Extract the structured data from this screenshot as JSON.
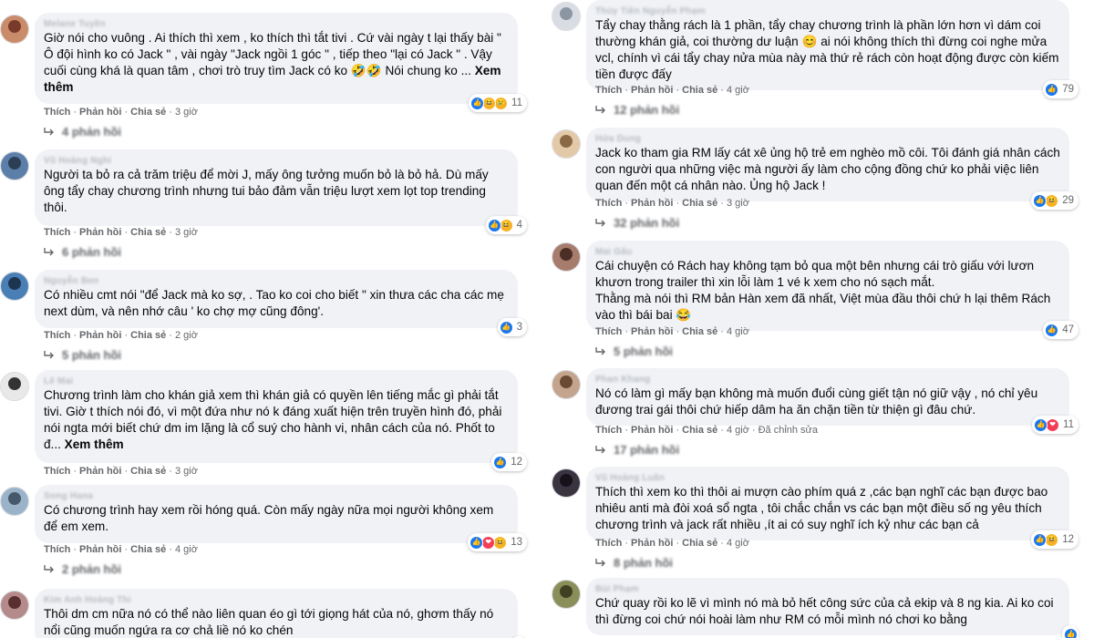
{
  "left_comments": [
    {
      "author": "Melane Tuyền",
      "text": "Giờ nói cho vuông . Ai thích thì xem , ko thích thì tắt tivi . Cứ vài ngày t lại thấy bài \" Ô đội hình ko có Jack \" , vài ngày \"Jack ngồi 1 góc \" , tiếp theo \"lại có Jack \" . Vậy cuối cùng khá là quan tâm , chơi trò truy tìm Jack có ko 🤣🤣 Nói chung ko ...",
      "see_more": "Xem thêm",
      "reactions": [
        "like",
        "haha",
        "sad"
      ],
      "reaction_count": "11",
      "action_like": "Thích",
      "action_reply": "Phản hồi",
      "action_share": "Chia sẻ",
      "time": "3 giờ",
      "replies": "4 phản hồi",
      "avatar_colors": [
        "#c98b6a",
        "#7a3a2a"
      ]
    },
    {
      "author": "Vũ Hoàng Nghi",
      "text": "Người ta bỏ ra cả trăm triệu để mời J, mấy ông tưởng muốn bỏ là bỏ hả. Dù mấy ông tẩy chay chương trình nhưng tui bảo đảm vẫn triệu lượt xem lọt top trending thôi.",
      "see_more": "",
      "reactions": [
        "like",
        "haha"
      ],
      "reaction_count": "4",
      "action_like": "Thích",
      "action_reply": "Phản hồi",
      "action_share": "Chia sẻ",
      "time": "3 giờ",
      "replies": "6 phản hồi",
      "avatar_colors": [
        "#5b7fa8",
        "#2b3e55"
      ]
    },
    {
      "author": "Nguyễn Ben",
      "text": "Có nhiều cmt nói \"để Jack mà ko sợ, . Tao ko coi cho biết \" xin thưa các cha các mẹ next dùm, và nên nhớ câu ' ko chợ mợ cũng đông'.",
      "see_more": "",
      "reactions": [
        "like"
      ],
      "reaction_count": "3",
      "action_like": "Thích",
      "action_reply": "Phản hồi",
      "action_share": "Chia sẻ",
      "time": "2 giờ",
      "replies": "5 phản hồi",
      "avatar_colors": [
        "#4a7fb5",
        "#1d3550"
      ]
    },
    {
      "author": "Lê Mai",
      "text": "Chương trình làm cho khán giả xem thì khán giả có quyền lên tiếng mắc gì phải tắt tivi. Giờ t thích nói đó, vì một đứa như nó k đáng xuất hiện trên truyền hình đó, phải nói ngta mới biết chứ dm im lặng là cổ suý cho hành vi, nhân cách của nó. Phốt to đ...",
      "see_more": "Xem thêm",
      "reactions": [
        "like"
      ],
      "reaction_count": "12",
      "action_like": "Thích",
      "action_reply": "Phản hồi",
      "action_share": "Chia sẻ",
      "time": "3 giờ",
      "replies": "",
      "avatar_colors": [
        "#e8e8e8",
        "#333333"
      ]
    },
    {
      "author": "Song Hana",
      "text": "Có chương trình hay xem rồi hóng quá. Còn mấy ngày nữa mọi người không xem để em xem.",
      "see_more": "",
      "reactions": [
        "like",
        "love",
        "haha"
      ],
      "reaction_count": "13",
      "action_like": "Thích",
      "action_reply": "Phản hồi",
      "action_share": "Chia sẻ",
      "time": "4 giờ",
      "replies": "2 phản hồi",
      "avatar_colors": [
        "#9bb3c9",
        "#46586b"
      ]
    },
    {
      "author": "Kim Anh Hoàng Thi",
      "text": "Thôi dm cm nữa nó có thể nào liên quan éo gì tới giọng hát của nó, ghơm thấy nó nổi cũng muốn ngứa ra cơ chả liề nó ko chén",
      "see_more": "",
      "reactions": [
        "like"
      ],
      "reaction_count": "",
      "action_like": "",
      "action_reply": "",
      "action_share": "",
      "time": "",
      "replies": "",
      "avatar_colors": [
        "#b48a8a",
        "#5a2f2f"
      ]
    }
  ],
  "right_comments": [
    {
      "author": "Thủy Tiên Nguyễn Phạm",
      "text": "Tẩy chay thằng rách là 1 phần, tẩy chay chương trình là phần lớn hơn vì dám coi thường khán giả, coi thường dư luận 😊 ai nói không thích thì đừng coi nghe mửa vcl, chính vì cái tẩy chay nửa mùa này mà thứ rẻ rách còn hoạt động được còn kiếm tiền được đấy",
      "see_more": "",
      "reactions": [
        "like"
      ],
      "reaction_count": "79",
      "action_like": "Thích",
      "action_reply": "Phản hồi",
      "action_share": "Chia sẻ",
      "time": "4 giờ",
      "replies": "12 phản hồi",
      "avatar_colors": [
        "#d9dde3",
        "#8c96a3"
      ]
    },
    {
      "author": "Hứa Dung",
      "text": "Jack ko tham gia RM lấy cát xê ủng hộ trẻ em nghèo mồ côi. Tôi đánh giá nhân cách con người qua những việc mà người ấy làm cho cộng đồng chứ ko phải việc liên quan đến một cá nhân nào. Ủng hộ Jack !",
      "see_more": "",
      "reactions": [
        "like",
        "haha"
      ],
      "reaction_count": "29",
      "action_like": "Thích",
      "action_reply": "Phản hồi",
      "action_share": "Chia sẻ",
      "time": "3 giờ",
      "replies": "32 phản hồi",
      "avatar_colors": [
        "#e3c9a8",
        "#8a6a45"
      ]
    },
    {
      "author": "Mai Gấu",
      "text": "Cái chuyện có Rách hay không tạm bỏ qua một bên nhưng cái trò giấu với lươn khươn trong trailer thì xin lỗi làm 1 vé k xem cho nó sạch mắt.\nThằng mà nói thì RM bản Hàn xem đã nhất, Việt mùa đầu thôi chứ h lại thêm Rách vào thì bái bai 😂",
      "see_more": "",
      "reactions": [
        "like"
      ],
      "reaction_count": "47",
      "action_like": "Thích",
      "action_reply": "Phản hồi",
      "action_share": "Chia sẻ",
      "time": "4 giờ",
      "replies": "5 phản hồi",
      "avatar_colors": [
        "#a67c6d",
        "#4b2e25"
      ]
    },
    {
      "author": "Phan Khang",
      "text": "Nó có làm gì mấy bạn không mà muốn đuổi cùng giết tận nó giữ vậy , nó chỉ yêu đương trai gái thôi chứ hiếp dâm ha ăn chặn tiền từ thiện gì đâu chứ.",
      "see_more": "",
      "reactions": [
        "like",
        "love"
      ],
      "reaction_count": "11",
      "action_like": "Thích",
      "action_reply": "Phản hồi",
      "action_share": "Chia sẻ",
      "time": "4 giờ",
      "edited": "Đã chỉnh sửa",
      "replies": "17 phản hồi",
      "avatar_colors": [
        "#c4a48d",
        "#6b4a35"
      ]
    },
    {
      "author": "Vũ Hoàng Luân",
      "text": "Thích thì xem ko thì thôi ai mượn cào phím quá z ,các bạn nghĩ các bạn được bao nhiêu anti mà đòi xoá sổ ngta , tôi chắc chắn vs các bạn một điều số ng yêu thích chương trình và jack rất nhiều ,ít ai có suy nghĩ ích kỷ như các bạn cả",
      "see_more": "",
      "reactions": [
        "like",
        "haha"
      ],
      "reaction_count": "12",
      "action_like": "Thích",
      "action_reply": "Phản hồi",
      "action_share": "Chia sẻ",
      "time": "4 giờ",
      "replies": "8 phản hồi",
      "avatar_colors": [
        "#3a3340",
        "#15121a"
      ]
    },
    {
      "author": "Bùi Phạm",
      "text": "Chứ quay rồi ko lẽ vì mình nó mà bỏ hết công sức của cả ekip và 8 ng kia. Ai ko coi thì đừng coi chứ nói hoài làm như RM có mỗi mình nó chơi ko bằng",
      "see_more": "",
      "reactions": [
        "like"
      ],
      "reaction_count": "",
      "action_like": "",
      "action_reply": "",
      "action_share": "",
      "time": "",
      "replies": "",
      "avatar_colors": [
        "#8a8f5a",
        "#3e4222"
      ]
    }
  ]
}
